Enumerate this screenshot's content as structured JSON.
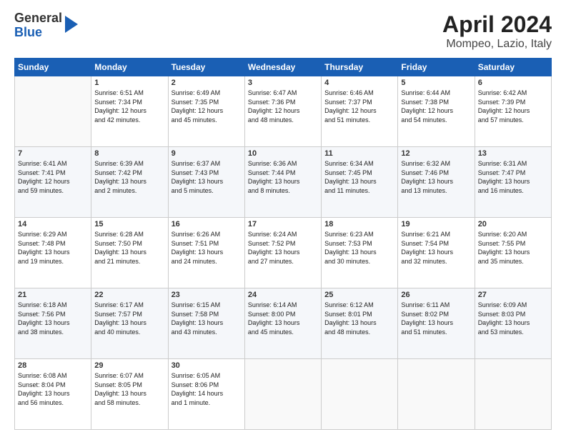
{
  "logo": {
    "general": "General",
    "blue": "Blue",
    "arrow": "▶"
  },
  "title": "April 2024",
  "subtitle": "Mompeo, Lazio, Italy",
  "headers": [
    "Sunday",
    "Monday",
    "Tuesday",
    "Wednesday",
    "Thursday",
    "Friday",
    "Saturday"
  ],
  "weeks": [
    [
      {
        "day": "",
        "info": ""
      },
      {
        "day": "1",
        "info": "Sunrise: 6:51 AM\nSunset: 7:34 PM\nDaylight: 12 hours\nand 42 minutes."
      },
      {
        "day": "2",
        "info": "Sunrise: 6:49 AM\nSunset: 7:35 PM\nDaylight: 12 hours\nand 45 minutes."
      },
      {
        "day": "3",
        "info": "Sunrise: 6:47 AM\nSunset: 7:36 PM\nDaylight: 12 hours\nand 48 minutes."
      },
      {
        "day": "4",
        "info": "Sunrise: 6:46 AM\nSunset: 7:37 PM\nDaylight: 12 hours\nand 51 minutes."
      },
      {
        "day": "5",
        "info": "Sunrise: 6:44 AM\nSunset: 7:38 PM\nDaylight: 12 hours\nand 54 minutes."
      },
      {
        "day": "6",
        "info": "Sunrise: 6:42 AM\nSunset: 7:39 PM\nDaylight: 12 hours\nand 57 minutes."
      }
    ],
    [
      {
        "day": "7",
        "info": "Sunrise: 6:41 AM\nSunset: 7:41 PM\nDaylight: 12 hours\nand 59 minutes."
      },
      {
        "day": "8",
        "info": "Sunrise: 6:39 AM\nSunset: 7:42 PM\nDaylight: 13 hours\nand 2 minutes."
      },
      {
        "day": "9",
        "info": "Sunrise: 6:37 AM\nSunset: 7:43 PM\nDaylight: 13 hours\nand 5 minutes."
      },
      {
        "day": "10",
        "info": "Sunrise: 6:36 AM\nSunset: 7:44 PM\nDaylight: 13 hours\nand 8 minutes."
      },
      {
        "day": "11",
        "info": "Sunrise: 6:34 AM\nSunset: 7:45 PM\nDaylight: 13 hours\nand 11 minutes."
      },
      {
        "day": "12",
        "info": "Sunrise: 6:32 AM\nSunset: 7:46 PM\nDaylight: 13 hours\nand 13 minutes."
      },
      {
        "day": "13",
        "info": "Sunrise: 6:31 AM\nSunset: 7:47 PM\nDaylight: 13 hours\nand 16 minutes."
      }
    ],
    [
      {
        "day": "14",
        "info": "Sunrise: 6:29 AM\nSunset: 7:48 PM\nDaylight: 13 hours\nand 19 minutes."
      },
      {
        "day": "15",
        "info": "Sunrise: 6:28 AM\nSunset: 7:50 PM\nDaylight: 13 hours\nand 21 minutes."
      },
      {
        "day": "16",
        "info": "Sunrise: 6:26 AM\nSunset: 7:51 PM\nDaylight: 13 hours\nand 24 minutes."
      },
      {
        "day": "17",
        "info": "Sunrise: 6:24 AM\nSunset: 7:52 PM\nDaylight: 13 hours\nand 27 minutes."
      },
      {
        "day": "18",
        "info": "Sunrise: 6:23 AM\nSunset: 7:53 PM\nDaylight: 13 hours\nand 30 minutes."
      },
      {
        "day": "19",
        "info": "Sunrise: 6:21 AM\nSunset: 7:54 PM\nDaylight: 13 hours\nand 32 minutes."
      },
      {
        "day": "20",
        "info": "Sunrise: 6:20 AM\nSunset: 7:55 PM\nDaylight: 13 hours\nand 35 minutes."
      }
    ],
    [
      {
        "day": "21",
        "info": "Sunrise: 6:18 AM\nSunset: 7:56 PM\nDaylight: 13 hours\nand 38 minutes."
      },
      {
        "day": "22",
        "info": "Sunrise: 6:17 AM\nSunset: 7:57 PM\nDaylight: 13 hours\nand 40 minutes."
      },
      {
        "day": "23",
        "info": "Sunrise: 6:15 AM\nSunset: 7:58 PM\nDaylight: 13 hours\nand 43 minutes."
      },
      {
        "day": "24",
        "info": "Sunrise: 6:14 AM\nSunset: 8:00 PM\nDaylight: 13 hours\nand 45 minutes."
      },
      {
        "day": "25",
        "info": "Sunrise: 6:12 AM\nSunset: 8:01 PM\nDaylight: 13 hours\nand 48 minutes."
      },
      {
        "day": "26",
        "info": "Sunrise: 6:11 AM\nSunset: 8:02 PM\nDaylight: 13 hours\nand 51 minutes."
      },
      {
        "day": "27",
        "info": "Sunrise: 6:09 AM\nSunset: 8:03 PM\nDaylight: 13 hours\nand 53 minutes."
      }
    ],
    [
      {
        "day": "28",
        "info": "Sunrise: 6:08 AM\nSunset: 8:04 PM\nDaylight: 13 hours\nand 56 minutes."
      },
      {
        "day": "29",
        "info": "Sunrise: 6:07 AM\nSunset: 8:05 PM\nDaylight: 13 hours\nand 58 minutes."
      },
      {
        "day": "30",
        "info": "Sunrise: 6:05 AM\nSunset: 8:06 PM\nDaylight: 14 hours\nand 1 minute."
      },
      {
        "day": "",
        "info": ""
      },
      {
        "day": "",
        "info": ""
      },
      {
        "day": "",
        "info": ""
      },
      {
        "day": "",
        "info": ""
      }
    ]
  ]
}
